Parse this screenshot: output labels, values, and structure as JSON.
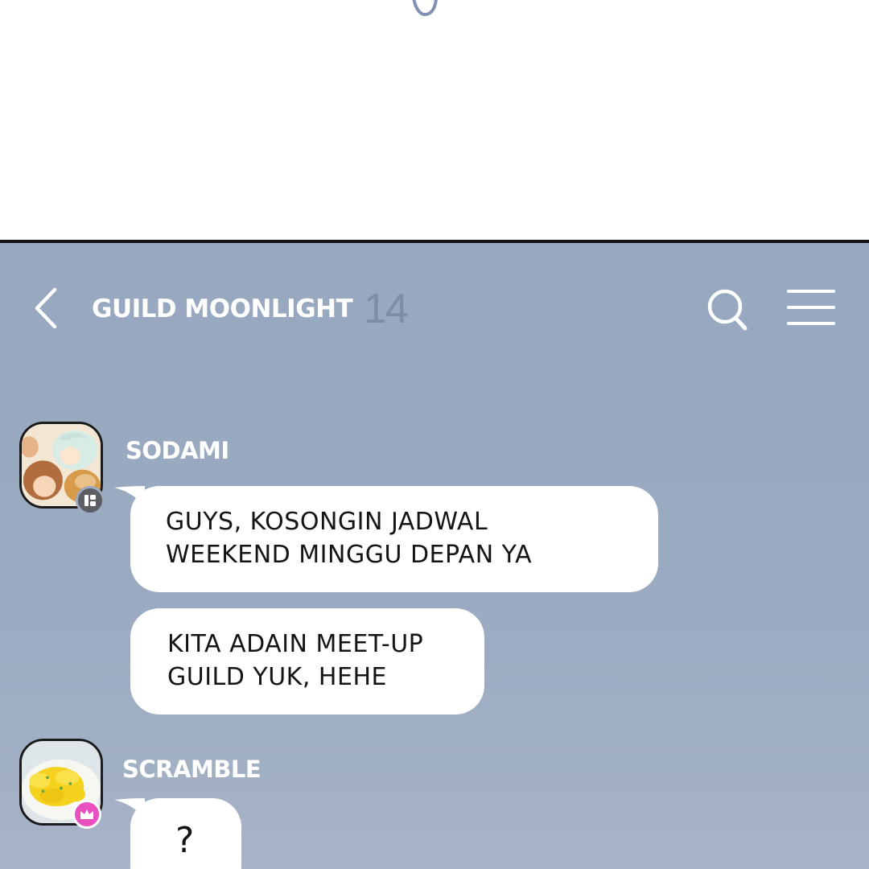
{
  "top_panel": {
    "scribble_icon": "scribble-icon"
  },
  "header": {
    "back_icon": "chevron-left-icon",
    "title": "GUILD MOONLIGHT",
    "member_count": "14",
    "search_icon": "search-icon",
    "menu_icon": "hamburger-menu-icon",
    "text_color": "#ffffff",
    "count_color": "#7f8ea5"
  },
  "chat": {
    "background_color": "#9aaac1",
    "bubble_color": "#ffffff",
    "messages": [
      {
        "sender": "SODAMI",
        "badge": "bookmark-badge-icon",
        "lines": [
          "GUYS, KOSONGIN JADWAL",
          "WEEKEND MINGGU DEPAN YA"
        ]
      },
      {
        "sender": "SODAMI",
        "lines": [
          "KITA ADAIN MEET-UP",
          "GUILD YUK, HEHE"
        ]
      },
      {
        "sender": "SCRAMBLE",
        "badge": "crown-badge-icon",
        "lines": [
          "?"
        ]
      }
    ]
  }
}
